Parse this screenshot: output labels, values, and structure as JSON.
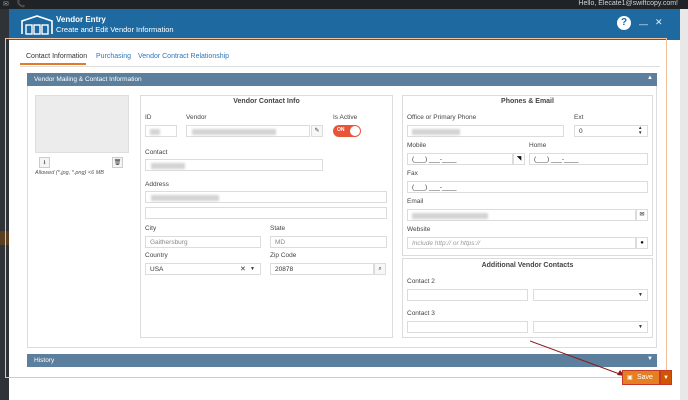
{
  "topbar": {
    "user_text": "Hello, Elecate1@swiftcopy.com!"
  },
  "modal": {
    "title": "Vendor Entry",
    "subtitle": "Create and Edit Vendor Information",
    "help_label": "?"
  },
  "tabs": [
    {
      "label": "Contact Information",
      "active": true
    },
    {
      "label": "Purchasing",
      "active": false
    },
    {
      "label": "Vendor Contract Relationship",
      "active": false
    }
  ],
  "section": {
    "title": "Vendor Mailing & Contact Information"
  },
  "photo": {
    "allowed": "Allowed (*.jpg, *.png) <6 MB"
  },
  "contact_info": {
    "title": "Vendor Contact Info",
    "id_label": "ID",
    "vendor_label": "Vendor",
    "is_active_label": "Is Active",
    "is_active_value": "ON",
    "contact_label": "Contact",
    "address_label": "Address",
    "city_label": "City",
    "city_value": "Gaithersburg",
    "state_label": "State",
    "state_value": "MD",
    "country_label": "Country",
    "country_value": "USA",
    "zip_label": "Zip Code",
    "zip_value": "20878"
  },
  "phones": {
    "title": "Phones & Email",
    "office_label": "Office or Primary Phone",
    "ext_label": "Ext",
    "ext_value": "0",
    "mobile_label": "Mobile",
    "mobile_value": "(___) ___-____",
    "home_label": "Home",
    "home_value": "(___) ___-____",
    "fax_label": "Fax",
    "fax_value": "(___) ___-____",
    "email_label": "Email",
    "website_label": "Website",
    "website_placeholder": "Include http:// or https://"
  },
  "additional": {
    "title": "Additional Vendor Contacts",
    "contact2_label": "Contact 2",
    "contact3_label": "Contact 3"
  },
  "history": {
    "title": "History"
  },
  "save": {
    "label": "Save"
  },
  "colors": {
    "header": "#1e6aa0",
    "section": "#5b7f9c",
    "accent": "#e67e22",
    "toggle": "#e8543a"
  }
}
